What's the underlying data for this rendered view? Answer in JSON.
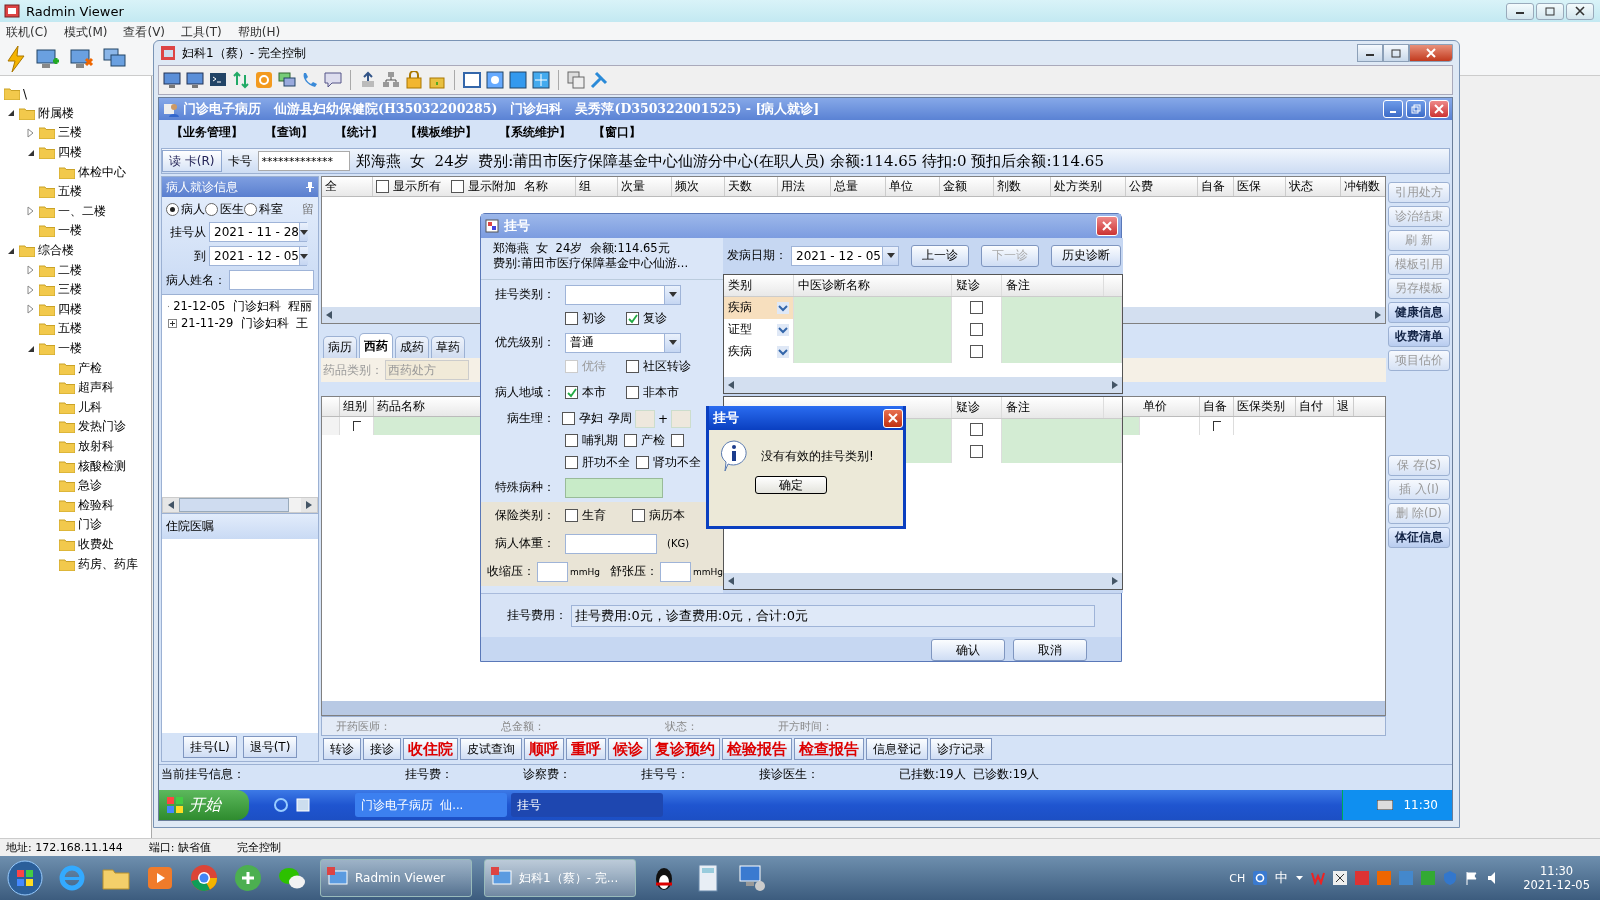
{
  "radmin": {
    "title": "Radmin Viewer",
    "menu": [
      "联机(C)",
      "模式(M)",
      "查看(V)",
      "工具(T)",
      "帮助(H)"
    ],
    "tree": {
      "root": "\\",
      "items": [
        {
          "label": "附属楼",
          "kind": "branch",
          "expanded": true,
          "children": [
            {
              "label": "三楼",
              "kind": "branch",
              "expanded": false
            },
            {
              "label": "四楼",
              "kind": "branch",
              "expanded": true,
              "children": [
                {
                  "label": "体检中心",
                  "kind": "leaf"
                }
              ]
            },
            {
              "label": "五楼",
              "kind": "leaf"
            },
            {
              "label": "一、二楼",
              "kind": "branch",
              "expanded": false
            },
            {
              "label": "一楼",
              "kind": "leaf"
            }
          ]
        },
        {
          "label": "综合楼",
          "kind": "branch",
          "expanded": true,
          "children": [
            {
              "label": "二楼",
              "kind": "branch",
              "expanded": false
            },
            {
              "label": "三楼",
              "kind": "branch",
              "expanded": false
            },
            {
              "label": "四楼",
              "kind": "branch",
              "expanded": false
            },
            {
              "label": "五楼",
              "kind": "leaf"
            },
            {
              "label": "一楼",
              "kind": "branch",
              "expanded": true,
              "children": [
                {
                  "label": "产检",
                  "kind": "leaf"
                },
                {
                  "label": "超声科",
                  "kind": "leaf"
                },
                {
                  "label": "儿科",
                  "kind": "leaf"
                },
                {
                  "label": "发热门诊",
                  "kind": "leaf"
                },
                {
                  "label": "放射科",
                  "kind": "leaf"
                },
                {
                  "label": "核酸检测",
                  "kind": "leaf"
                },
                {
                  "label": "急诊",
                  "kind": "leaf"
                },
                {
                  "label": "检验科",
                  "kind": "leaf"
                },
                {
                  "label": "门诊",
                  "kind": "leaf"
                },
                {
                  "label": "收费处",
                  "kind": "leaf"
                },
                {
                  "label": "药房、药库",
                  "kind": "leaf"
                }
              ]
            }
          ]
        }
      ]
    },
    "status_bar": {
      "address": "地址: 172.168.11.144",
      "port": "端口: 缺省值",
      "mode": "完全控制"
    }
  },
  "remote_window": {
    "title": "妇科1（蔡）- 完全控制"
  },
  "emr": {
    "title": "门诊电子病历   仙游县妇幼保健院(H35032200285)   门诊妇科   吴秀萍(D350322001525) - [病人就诊]",
    "menu": [
      "【业务管理】",
      "【查询】",
      "【统计】",
      "【模板维护】",
      "【系统维护】",
      "【窗口】"
    ],
    "card": {
      "read_button": "读 卡(R)",
      "card_label": "卡号",
      "card_value": "*************",
      "patient_line": "郑海燕  女  24岁  费别:莆田市医疗保障基金中心仙游分中心(在职人员) 余额:114.65 待扣:0 预扣后余额:114.65"
    },
    "left_panel": {
      "title": "病人就诊信息",
      "filter": [
        {
          "label": "病人",
          "selected": true
        },
        {
          "label": "医生",
          "selected": false
        },
        {
          "label": "科室",
          "selected": false
        }
      ],
      "extra": "留",
      "from_label": "挂号从",
      "from": "2021 - 11 - 28",
      "to_label": "到",
      "to": "2021 - 12 - 05",
      "name_label": "病人姓名：",
      "visits": [
        {
          "date": "21-12-05",
          "dept": "门诊妇科",
          "name": "程丽"
        },
        {
          "date": "21-11-29",
          "dept": "门诊妇科",
          "name": "王"
        }
      ],
      "orders_title": "住院医嘱",
      "buttons": [
        "挂号(L)",
        "退号(T)"
      ]
    },
    "prescription_grid": {
      "select_all": "全",
      "options": [
        {
          "label": "显示所有",
          "checked": false
        },
        {
          "label": "显示附加",
          "checked": false
        }
      ],
      "columns": [
        "名称",
        "组",
        "次量",
        "频次",
        "天数",
        "用法",
        "总量",
        "单位",
        "金额",
        "剂数",
        "处方类别",
        "公费",
        "自备",
        "医保",
        "状态",
        "冲销数"
      ]
    },
    "tabs": [
      {
        "label": "病历",
        "selected": false
      },
      {
        "label": "西药",
        "selected": true
      },
      {
        "label": "成药",
        "selected": false
      },
      {
        "label": "草药",
        "selected": false
      }
    ],
    "drug_type_label": "药品类别：",
    "drug_type": "西药处方",
    "drug_grid": {
      "columns_left": [
        "组别",
        "药品名称"
      ],
      "columns_right": [
        "单价",
        "自备",
        "医保类别",
        "自付",
        "退"
      ],
      "rows": [
        {
          "group_checked": false,
          "self_checked": false
        }
      ]
    },
    "side_buttons_top": [
      {
        "label": "引用处方",
        "disabled": true
      },
      {
        "label": "诊治结束",
        "disabled": true
      },
      {
        "label": "刷 新",
        "disabled": true
      },
      {
        "label": "模板引用",
        "disabled": true
      },
      {
        "label": "另存模板",
        "disabled": true
      },
      {
        "label": "健康信息",
        "disabled": false
      },
      {
        "label": "收费清单",
        "disabled": false
      },
      {
        "label": "项目估价",
        "disabled": true
      }
    ],
    "side_buttons_bottom": [
      {
        "label": "保 存(S)",
        "disabled": true
      },
      {
        "label": "插 入(I)",
        "disabled": true
      },
      {
        "label": "删 除(D)",
        "disabled": true
      },
      {
        "label": "体征信息",
        "disabled": false
      }
    ],
    "footer": [
      "开药医师：",
      "总金额：",
      "状态：",
      "开方时间："
    ],
    "actions": [
      {
        "label": "转诊",
        "kind": "normal"
      },
      {
        "label": "接诊",
        "kind": "normal"
      },
      {
        "label": "收住院",
        "kind": "alert"
      },
      {
        "label": "皮试查询",
        "kind": "normal"
      },
      {
        "label": "顺呼",
        "kind": "alert"
      },
      {
        "label": "重呼",
        "kind": "alert"
      },
      {
        "label": "候诊",
        "kind": "alert"
      },
      {
        "label": "复诊预约",
        "kind": "alert"
      },
      {
        "label": "检验报告",
        "kind": "alert"
      },
      {
        "label": "检查报告",
        "kind": "alert"
      },
      {
        "label": "信息登记",
        "kind": "normal"
      },
      {
        "label": "诊疗记录",
        "kind": "normal"
      }
    ],
    "status": [
      "当前挂号信息：",
      "挂号费：",
      "诊察费：",
      "挂号号：",
      "接诊医生：",
      "已挂数:19人  已诊数:19人"
    ],
    "xp_taskbar": {
      "start": "开始",
      "tasks": [
        {
          "label": "门诊电子病历  仙...",
          "selected": false
        },
        {
          "label": "挂号",
          "selected": true
        }
      ],
      "clock": "11:30"
    }
  },
  "register_dialog": {
    "title": "挂号",
    "info": [
      "郑海燕  女  24岁  余额:114.65元",
      "费别:莆田市医疗保障基金中心仙游…"
    ],
    "type_label": "挂号类别：",
    "visit": [
      {
        "label": "初诊",
        "checked": false
      },
      {
        "label": "复诊",
        "checked": true
      }
    ],
    "priority_label": "优先级别：",
    "priority": "普通",
    "priority_flags": [
      {
        "label": "优待",
        "checked": false,
        "disabled": true
      },
      {
        "label": "社区转诊",
        "checked": false,
        "disabled": false
      }
    ],
    "region_label": "病人地域：",
    "region": [
      {
        "label": "本市",
        "checked": true
      },
      {
        "label": "非本市",
        "checked": false
      }
    ],
    "physio_label": "病生理：",
    "pregnant": {
      "label": "孕妇",
      "checked": false
    },
    "week_label": "孕周",
    "week_plus": "+",
    "physio_more": [
      {
        "label": "哺乳期",
        "checked": false
      },
      {
        "label": "产检",
        "checked": false
      },
      {
        "checked": false
      }
    ],
    "physio_organs": [
      {
        "label": "肝功不全",
        "checked": false
      },
      {
        "label": "肾功不全",
        "checked": false
      }
    ],
    "special_label": "特殊病种：",
    "insurance_label": "保险类别：",
    "insurance": [
      {
        "label": "生育",
        "checked": false
      },
      {
        "label": "病历本",
        "checked": false
      }
    ],
    "weight_label": "病人体重：",
    "weight_unit": "(KG)",
    "systolic_label": "收缩压：",
    "systolic_unit": "mmHg",
    "diastolic_label": "舒张压：",
    "diastolic_unit": "mmHg",
    "onset_label": "发病日期：",
    "onset": "2021 - 12 - 05",
    "nav": [
      {
        "label": "上一诊",
        "disabled": false
      },
      {
        "label": "下一诊",
        "disabled": true
      },
      {
        "label": "历史诊断",
        "disabled": false
      }
    ],
    "tcm": {
      "columns": [
        "类别",
        "中医诊断名称",
        "疑诊",
        "备注"
      ],
      "rows": [
        {
          "category": "疾病",
          "suspected": false,
          "selected": true
        },
        {
          "category": "证型",
          "suspected": false,
          "selected": false
        },
        {
          "category": "疾病",
          "suspected": false,
          "selected": false
        }
      ]
    },
    "western": {
      "columns": [
        "疑诊",
        "备注"
      ],
      "rows": [
        {
          "suspected": false
        },
        {
          "suspected": false
        }
      ]
    },
    "fee_label": "挂号费用：",
    "fee": "挂号费用:0元，诊查费用:0元，合计:0元",
    "buttons": [
      "确认",
      "取消"
    ]
  },
  "message_box": {
    "title": "挂号",
    "text": "没有有效的挂号类别!",
    "button": "确定"
  },
  "taskbar": {
    "tasks": [
      {
        "label": "Radmin Viewer",
        "selected": false
      },
      {
        "label": "妇科1（蔡）- 完...",
        "selected": true
      }
    ],
    "tray": [
      "CH",
      "中"
    ],
    "time": "11:30",
    "date": "2021-12-05"
  }
}
